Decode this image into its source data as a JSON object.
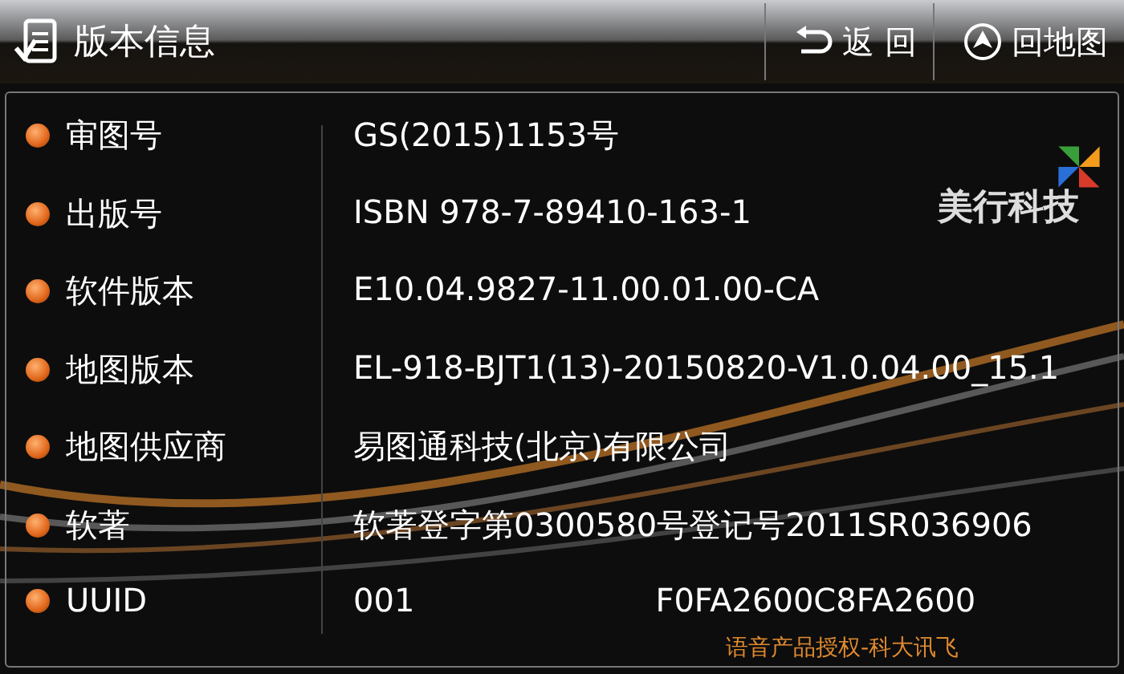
{
  "header": {
    "title": "版本信息",
    "buttons": [
      {
        "kind": "back",
        "label": "返 回"
      },
      {
        "kind": "map",
        "label": "回地图"
      }
    ]
  },
  "logo": {
    "text": "美行科技"
  },
  "rows": [
    {
      "label": "审图号",
      "value": [
        "GS(2015)1153号"
      ]
    },
    {
      "label": "出版号",
      "value": [
        "ISBN 978-7-89410-163-1"
      ]
    },
    {
      "label": "软件版本",
      "value": [
        "E10.04.9827-11.00.01.00-CA"
      ]
    },
    {
      "label": "地图版本",
      "value": [
        "EL-918-BJT1(13)-20150820-V1.0.04.00_15.1"
      ]
    },
    {
      "label": "地图供应商",
      "value": [
        "易图通科技(北京)有限公司"
      ]
    },
    {
      "label": "软著",
      "value": [
        "软著登字第0300580号登记号2011SR036906"
      ]
    },
    {
      "label": "UUID",
      "value": [
        "001",
        "F0FA2600C8FA2600"
      ]
    }
  ],
  "footer": "语音产品授权-科大讯飞"
}
